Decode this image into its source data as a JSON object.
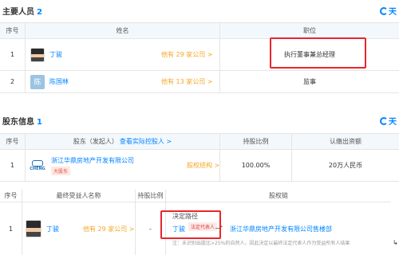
{
  "main_personnel": {
    "title": "主要人员",
    "count": "2",
    "headers": {
      "index": "序号",
      "name": "姓名",
      "position": "职位"
    },
    "rows": [
      {
        "index": "1",
        "name": "丁骏",
        "companies": "他有 29 家公司 >",
        "position": "执行董事兼总经理"
      },
      {
        "index": "2",
        "avatar_text": "陈",
        "name": "陈国林",
        "companies": "他有 13 家公司 >",
        "position": "监事"
      }
    ]
  },
  "shareholders": {
    "title": "股东信息",
    "count": "1",
    "headers": {
      "index": "序号",
      "shareholder": "股东（发起人）",
      "actual_link": "查看实际控股人 >",
      "ratio": "持股比例",
      "subscribed": "认缴出资额"
    },
    "rows": [
      {
        "index": "1",
        "logo_text": "CHENG",
        "company": "浙江华鼎房地产开发有限公司",
        "tag": "大股东",
        "structure": "股权结构 >",
        "ratio": "100.00%",
        "amount": "20万人民币"
      }
    ]
  },
  "beneficiaries": {
    "headers": {
      "index": "序号",
      "name": "最终受益人名称",
      "ratio": "持股比例",
      "chain": "股权链"
    },
    "rows": [
      {
        "index": "1",
        "name": "丁骏",
        "companies": "他有 29 家公司 >",
        "ratio": "-",
        "decision_label": "决定路径",
        "chain_person": "丁骏",
        "legal_rep_tag": "法定代表人",
        "chain_company": "浙江华鼎房地产开发有限公司售楼部",
        "note": "注：未识别出股比>25%的自然人，因此决定以最终法定代表人作为受益所有人结果"
      }
    ]
  },
  "logo": "天"
}
